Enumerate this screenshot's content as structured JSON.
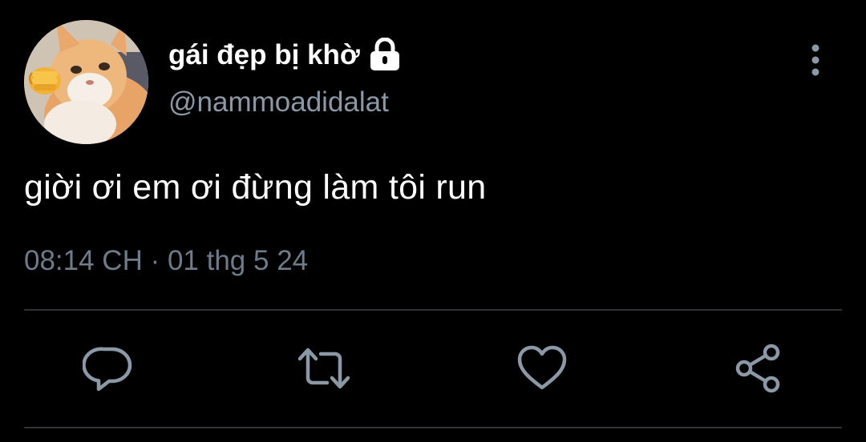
{
  "tweet": {
    "display_name": "gái đẹp bị khờ",
    "protected_icon": "lock-icon",
    "handle": "@nammoadidalat",
    "text": "giời ơi em ơi đừng làm tôi run",
    "timestamp": "08:14 CH · 01 thg 5 24",
    "more_icon": "more-vertical-icon"
  },
  "actions": [
    {
      "icon": "reply-icon"
    },
    {
      "icon": "retweet-icon"
    },
    {
      "icon": "like-icon"
    },
    {
      "icon": "share-icon"
    }
  ],
  "colors": {
    "background": "#000000",
    "text": "#ffffff",
    "secondary_text": "#8b98a5",
    "timestamp": "#6e7b89",
    "icon": "#8b98a5",
    "divider": "#2f3336"
  }
}
